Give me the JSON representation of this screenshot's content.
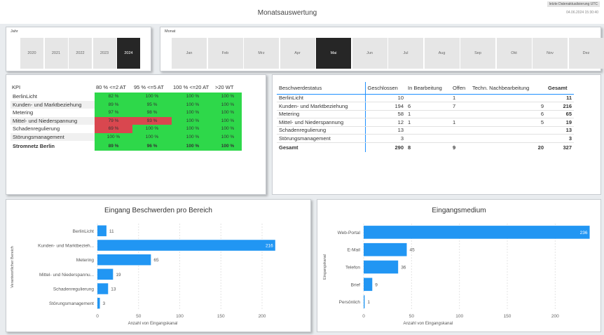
{
  "header": {
    "title": "Monatsauswertung",
    "refresh_label": "letzte Datenaktualisierung UTC",
    "refresh_date": "04.06.2024 15:30:40"
  },
  "year_slicer": {
    "title": "Jahr",
    "options": [
      "2020",
      "2021",
      "2022",
      "2023",
      "2024"
    ],
    "selected": "2024"
  },
  "month_slicer": {
    "title": "Monat",
    "options": [
      "Jan",
      "Feb",
      "Mrz",
      "Apr",
      "Mai",
      "Jun",
      "Jul",
      "Aug",
      "Sep",
      "Okt",
      "Nov",
      "Dez"
    ],
    "selected": "Mai"
  },
  "kpi_table": {
    "headers": [
      "KPI",
      "80 % <=2 AT",
      "95 % <=5 AT",
      "100 % <=20 AT",
      ">20 WT"
    ],
    "rows": [
      {
        "name": "BerlinLicht",
        "values": [
          "82 %",
          "100 %",
          "100 %",
          "100 %"
        ],
        "status": [
          "green",
          "green",
          "green",
          "green"
        ]
      },
      {
        "name": "Kunden- und Marktbeziehung",
        "values": [
          "89 %",
          "95 %",
          "100 %",
          "100 %"
        ],
        "status": [
          "green",
          "green",
          "green",
          "green"
        ]
      },
      {
        "name": "Metering",
        "values": [
          "97 %",
          "98 %",
          "100 %",
          "100 %"
        ],
        "status": [
          "green",
          "green",
          "green",
          "green"
        ]
      },
      {
        "name": "Mittel- und Niederspannung",
        "values": [
          "79 %",
          "93 %",
          "100 %",
          "100 %"
        ],
        "status": [
          "red",
          "red",
          "green",
          "green"
        ]
      },
      {
        "name": "Schadenregulierung",
        "values": [
          "69 %",
          "100 %",
          "100 %",
          "100 %"
        ],
        "status": [
          "red",
          "green",
          "green",
          "green"
        ]
      },
      {
        "name": "Störungsmanagement",
        "values": [
          "100 %",
          "100 %",
          "100 %",
          "100 %"
        ],
        "status": [
          "green",
          "green",
          "green",
          "green"
        ]
      }
    ],
    "total": {
      "name": "Stromnetz Berlin",
      "values": [
        "89 %",
        "96 %",
        "100 %",
        "100 %"
      ],
      "status": [
        "green",
        "green",
        "green",
        "green"
      ]
    },
    "colors": {
      "green": "#2ed84a",
      "red": "#d9474f"
    }
  },
  "complaint_table": {
    "headers": [
      "Beschwerdestatus",
      "Geschlossen",
      "In Bearbeitung",
      "Offen",
      "Techn. Nachbearbeitung",
      "Gesamt"
    ],
    "rows": [
      [
        "BerlinLicht",
        "10",
        "",
        "1",
        "",
        "11"
      ],
      [
        "Kunden- und Marktbeziehung",
        "194",
        "6",
        "7",
        "9",
        "216"
      ],
      [
        "Metering",
        "58",
        "1",
        "",
        "6",
        "65"
      ],
      [
        "Mittel- und Niederspannung",
        "12",
        "1",
        "1",
        "5",
        "19"
      ],
      [
        "Schadenregulierung",
        "13",
        "",
        "",
        "",
        "13"
      ],
      [
        "Störungsmanagement",
        "3",
        "",
        "",
        "",
        "3"
      ]
    ],
    "total": [
      "Gesamt",
      "290",
      "8",
      "9",
      "20",
      "327"
    ]
  },
  "chart_data": [
    {
      "type": "bar",
      "orientation": "horizontal",
      "title": "Eingang Beschwerden pro Bereich",
      "xlabel": "Anzahl von Eingangskanal",
      "ylabel": "Verantwortlicher Bereich",
      "categories": [
        "BerlinLicht",
        "Kunden- und Marktbezieh...",
        "Metering",
        "Mittel- und Niederspannu...",
        "Schadenregulierung",
        "Störungsmanagement"
      ],
      "values": [
        11,
        216,
        65,
        19,
        13,
        3
      ],
      "xlim": [
        0,
        240
      ],
      "xticks": [
        "0",
        "50",
        "100",
        "150",
        "200"
      ],
      "color": "#2196f3"
    },
    {
      "type": "bar",
      "orientation": "horizontal",
      "title": "Eingangsmedium",
      "xlabel": "Anzahl von Eingangskanal",
      "ylabel": "Eingangskanal",
      "categories": [
        "Web-Portal",
        "E-Mail",
        "Telefon",
        "Brief",
        "Persönlich"
      ],
      "values": [
        236,
        45,
        36,
        9,
        1
      ],
      "xlim": [
        0,
        240
      ],
      "xticks": [
        "0",
        "50",
        "100",
        "150",
        "200"
      ],
      "color": "#2196f3"
    }
  ]
}
